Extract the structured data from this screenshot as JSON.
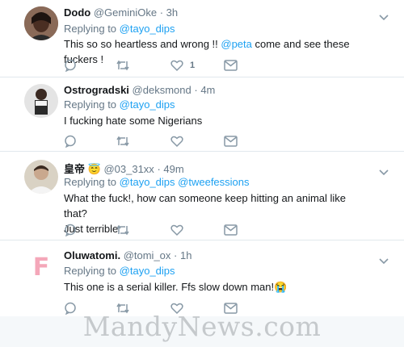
{
  "tweets": [
    {
      "name": "Dodo",
      "handle": "@GeminiOke",
      "time": "3h",
      "reply_prefix": "Replying to",
      "reply_to": "@tayo_dips",
      "reply_to_2": "",
      "body_pre": "This so so heartless and wrong !! ",
      "body_link": "@peta",
      "body_post": " come and see these fuckers !",
      "likes": "1"
    },
    {
      "name": "Ostrogradski",
      "handle": "@deksmond",
      "time": "4m",
      "reply_prefix": "Replying to",
      "reply_to": "@tayo_dips",
      "body": "I fucking hate some Nigerians"
    },
    {
      "name": "皇帝",
      "name_emoji": "😇",
      "handle": "@03_31xx",
      "time": "49m",
      "reply_prefix": "Replying to",
      "reply_to": "@tayo_dips",
      "reply_to_2": "@tweefessions",
      "body_line1": "What the fuck!, how can someone keep hitting an animal like that?",
      "body_line2": "Just terrible"
    },
    {
      "name": "Oluwatomi.",
      "handle": "@tomi_ox",
      "time": "1h",
      "avatar_letter": "F",
      "reply_prefix": "Replying to",
      "reply_to": "@tayo_dips",
      "body": "This one is a serial killer. Ffs slow down man!",
      "body_emoji": "😭"
    }
  ],
  "separator": "·",
  "watermark": "MandyNews.com",
  "colors": {
    "link": "#1da1f2",
    "muted": "#657786",
    "text": "#14171a",
    "border": "#e1e8ed",
    "avatar_letter": "#f4a7b9"
  },
  "icons": [
    "reply-icon",
    "retweet-icon",
    "like-icon",
    "dm-icon",
    "chevron-down-icon"
  ]
}
